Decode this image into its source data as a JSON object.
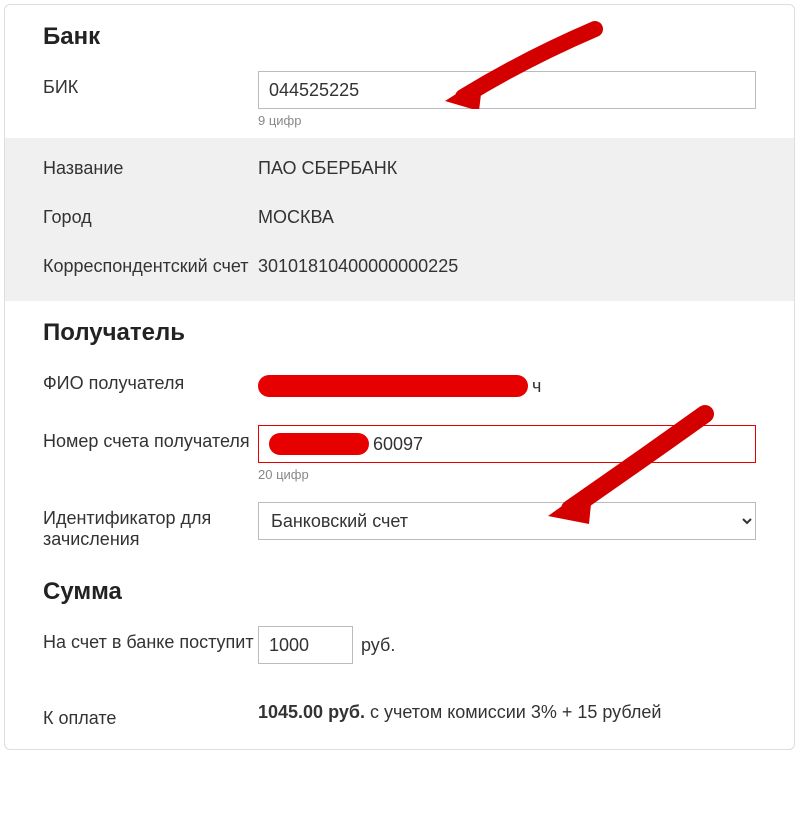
{
  "bank": {
    "section_title": "Банк",
    "bik_label": "БИК",
    "bik_value": "044525225",
    "bik_hint": "9 цифр",
    "name_label": "Название",
    "name_value": "ПАО СБЕРБАНК",
    "city_label": "Город",
    "city_value": "МОСКВА",
    "corr_label": "Корреспондентский счет",
    "corr_value": "30101810400000000225"
  },
  "recipient": {
    "section_title": "Получатель",
    "fio_label": "ФИО получателя",
    "fio_suffix": "ч",
    "account_label": "Номер счета получателя",
    "account_visible": "60097",
    "account_hint": "20 цифр",
    "id_label": "Идентификатор для зачисления",
    "id_value": "Банковский счет"
  },
  "sum": {
    "section_title": "Сумма",
    "arrive_label": "На счет в банке поступит",
    "arrive_value": "1000",
    "unit": "руб.",
    "pay_label": "К оплате",
    "pay_amount": "1045.00 руб.",
    "pay_note": " с учетом комиссии 3% + 15 рублей"
  }
}
